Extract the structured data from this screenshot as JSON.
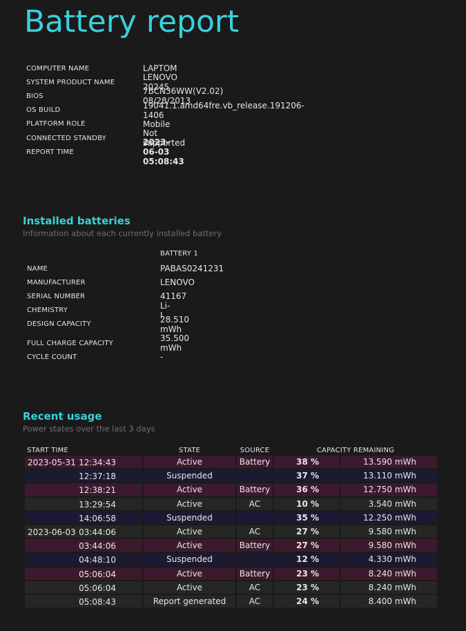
{
  "title": "Battery report",
  "system": [
    {
      "label": "COMPUTER NAME",
      "value": "LAPTOM"
    },
    {
      "label": "SYSTEM PRODUCT NAME",
      "value": "LENOVO 20245"
    },
    {
      "label": "BIOS",
      "value": "7BCN36WW(V2.02) 08/28/2013"
    },
    {
      "label": "OS BUILD",
      "value": "19041.1.amd64fre.vb_release.191206-1406"
    },
    {
      "label": "PLATFORM ROLE",
      "value": "Mobile"
    },
    {
      "label": "CONNECTED STANDBY",
      "value": "Not supported"
    },
    {
      "label": "REPORT TIME",
      "value": "2023-06-03  05:08:43"
    }
  ],
  "installed": {
    "title": "Installed batteries",
    "subtitle": "Information about each currently installed battery",
    "column": "BATTERY 1",
    "rows": [
      {
        "label": "NAME",
        "value": "PABAS0241231"
      },
      {
        "label": "MANUFACTURER",
        "value": "LENOVO"
      },
      {
        "label": "SERIAL NUMBER",
        "value": "41167"
      },
      {
        "label": "CHEMISTRY",
        "value": "Li-I"
      },
      {
        "label": "DESIGN CAPACITY",
        "value": "28.510 mWh"
      },
      {
        "label": "FULL CHARGE CAPACITY",
        "value": "35.500 mWh"
      },
      {
        "label": "CYCLE COUNT",
        "value": "-"
      }
    ]
  },
  "recent": {
    "title": "Recent usage",
    "subtitle": "Power states over the last 3 days",
    "headers": {
      "start": "START TIME",
      "state": "STATE",
      "source": "SOURCE",
      "capacity": "CAPACITY REMAINING"
    },
    "rows": [
      {
        "date": "2023-05-31",
        "time": "12:34:43",
        "state": "Active",
        "source": "Battery",
        "pct": "38 %",
        "cap": "13.590 mWh",
        "kind": "active-battery"
      },
      {
        "date": "",
        "time": "12:37:18",
        "state": "Suspended",
        "source": "",
        "pct": "37 %",
        "cap": "13.110 mWh",
        "kind": "suspended"
      },
      {
        "date": "",
        "time": "12:38:21",
        "state": "Active",
        "source": "Battery",
        "pct": "36 %",
        "cap": "12.750 mWh",
        "kind": "active-battery"
      },
      {
        "date": "",
        "time": "13:29:54",
        "state": "Active",
        "source": "AC",
        "pct": "10 %",
        "cap": "3.540 mWh",
        "kind": "ac"
      },
      {
        "date": "",
        "time": "14:06:58",
        "state": "Suspended",
        "source": "",
        "pct": "35 %",
        "cap": "12.250 mWh",
        "kind": "suspended"
      },
      {
        "date": "2023-06-03",
        "time": "03:44:06",
        "state": "Active",
        "source": "AC",
        "pct": "27 %",
        "cap": "9.580 mWh",
        "kind": "ac"
      },
      {
        "date": "",
        "time": "03:44:06",
        "state": "Active",
        "source": "Battery",
        "pct": "27 %",
        "cap": "9.580 mWh",
        "kind": "active-battery"
      },
      {
        "date": "",
        "time": "04:48:10",
        "state": "Suspended",
        "source": "",
        "pct": "12 %",
        "cap": "4.330 mWh",
        "kind": "suspended"
      },
      {
        "date": "",
        "time": "05:06:04",
        "state": "Active",
        "source": "Battery",
        "pct": "23 %",
        "cap": "8.240 mWh",
        "kind": "active-battery"
      },
      {
        "date": "",
        "time": "05:06:04",
        "state": "Active",
        "source": "AC",
        "pct": "23 %",
        "cap": "8.240 mWh",
        "kind": "ac"
      },
      {
        "date": "",
        "time": "05:08:43",
        "state": "Report generated",
        "source": "AC",
        "pct": "24 %",
        "cap": "8.400 mWh",
        "kind": "report"
      }
    ]
  },
  "colors": {
    "accent": "#3ad0dd",
    "background": "#1a1a1a",
    "battery_row": "#3c1a2e",
    "suspended_row": "#1c1a33",
    "ac_row": "#262626"
  }
}
